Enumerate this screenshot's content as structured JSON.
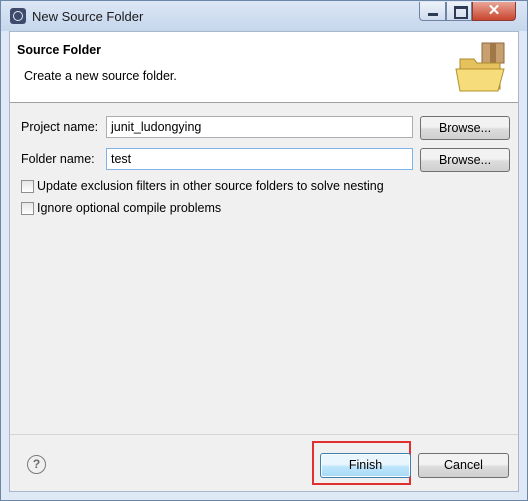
{
  "window": {
    "title": "New Source Folder",
    "minimize_glyph": "",
    "maximize_glyph": "",
    "close_glyph": "✕"
  },
  "header": {
    "title": "Source Folder",
    "description": "Create a new source folder.",
    "icon": "folder-package-icon"
  },
  "form": {
    "project_label": "Project name:",
    "project_value": "junit_ludongying",
    "folder_label": "Folder name:",
    "folder_value": "test",
    "browse_label": "Browse..."
  },
  "options": [
    {
      "label": "Update exclusion filters in other source folders to solve nesting",
      "checked": false
    },
    {
      "label": "Ignore optional compile problems",
      "checked": false
    }
  ],
  "footer": {
    "help_glyph": "?",
    "finish_label": "Finish",
    "cancel_label": "Cancel"
  },
  "colors": {
    "highlight": "#e03030",
    "default_button": "#a7d9f5"
  }
}
